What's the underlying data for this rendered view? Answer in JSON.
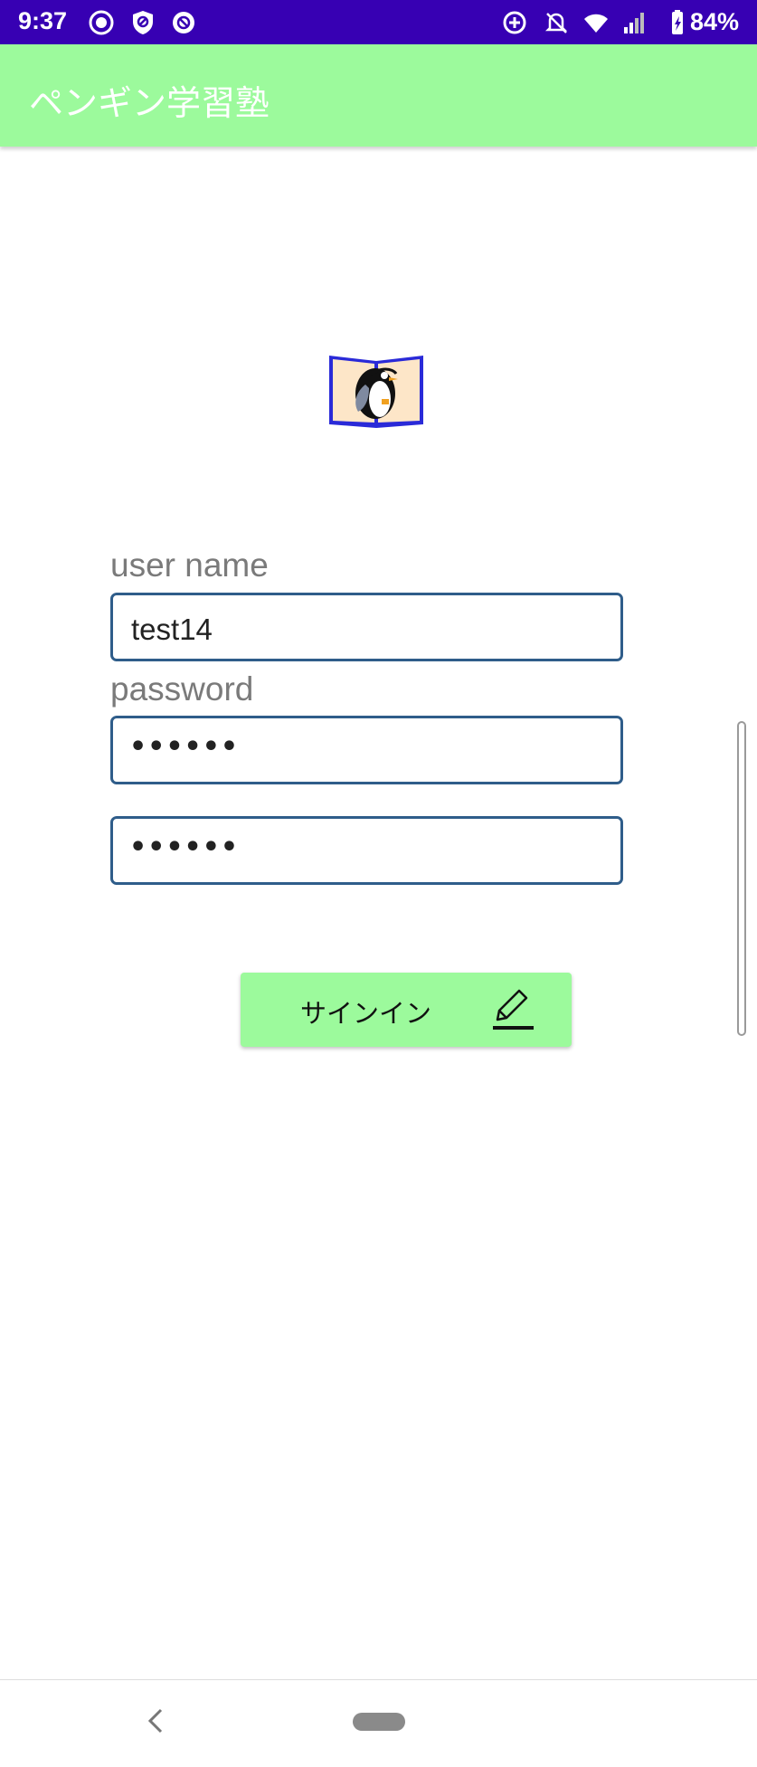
{
  "status_bar": {
    "time": "9:37",
    "battery": "84%",
    "icons": [
      "app-notification-icon",
      "shield-icon",
      "app-notification-icon",
      "data-saver-icon",
      "mute-icon",
      "wifi-icon",
      "signal-icon",
      "battery-icon"
    ]
  },
  "app_bar": {
    "title": "ペンギン学習塾",
    "color": "#9cfa9c"
  },
  "logo": {
    "icon": "penguin-book-icon"
  },
  "form": {
    "username_label": "user name",
    "username_value": "test14",
    "password_label": "password",
    "password_value": "••••••",
    "password_confirm_value": "••••••"
  },
  "signin_button": {
    "label": "サインイン",
    "icon": "edit-icon",
    "color": "#9cfa9c"
  },
  "colors": {
    "status_bar": "#3700b3",
    "input_border": "#2f5d8a"
  },
  "nav_bar": {
    "icons": [
      "back-icon",
      "home-pill"
    ]
  }
}
